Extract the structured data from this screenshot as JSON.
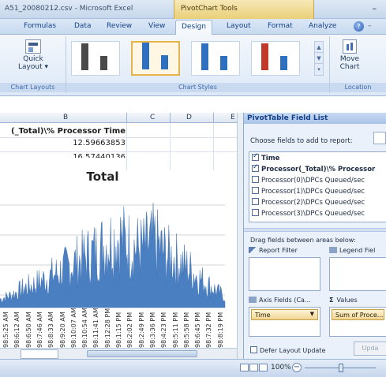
{
  "window": {
    "title": "A51_20080212.csv - Microsoft Excel",
    "context_tools": "PivotChart Tools"
  },
  "ribbon": {
    "tabs": [
      {
        "label": "Formulas"
      },
      {
        "label": "Data"
      },
      {
        "label": "Review"
      },
      {
        "label": "View"
      },
      {
        "label": "Design"
      },
      {
        "label": "Layout"
      },
      {
        "label": "Format"
      },
      {
        "label": "Analyze"
      }
    ],
    "active_tab": "Design",
    "quick_layout_label": "Quick Layout",
    "chart_layouts_group": "Chart Layouts",
    "chart_styles_group": "Chart Styles",
    "move_chart_label": "Move Chart",
    "location_group": "Location",
    "style_swatch_colors": [
      "#4a4a4a",
      "#2f6fbf",
      "#2f6fbf",
      "#c0392b"
    ],
    "selected_style_index": 1
  },
  "sheet": {
    "column_headers": [
      "B",
      "C",
      "D",
      "E"
    ],
    "header_cell": "(_Total)\\% Processor Time",
    "values": [
      "12.59663853",
      "16.57440136"
    ]
  },
  "chart": {
    "title": "Total",
    "series_color": "#4a7fc1",
    "x_labels": [
      "98:5:25 AM",
      "98:6:12 AM",
      "98:6:50 AM",
      "98:7:46 AM",
      "98:8:33 AM",
      "98:9:20 AM",
      "98:10:07 AM",
      "98:10:54 AM",
      "98:11:41 AM",
      "98:12:28 PM",
      "98:1:15 PM",
      "98:2:02 PM",
      "98:2:49 PM",
      "98:3:36 PM",
      "98:4:23 PM",
      "98:5:11 PM",
      "98:5:58 PM",
      "98:6:45 PM",
      "98:7:32 PM",
      "98:8:19 PM"
    ]
  },
  "chart_data": {
    "type": "area",
    "title": "Total",
    "x": [
      "98:5:25 AM",
      "98:6:12 AM",
      "98:6:50 AM",
      "98:7:46 AM",
      "98:8:33 AM",
      "98:9:20 AM",
      "98:10:07 AM",
      "98:10:54 AM",
      "98:11:41 AM",
      "98:12:28 PM",
      "98:1:15 PM",
      "98:2:02 PM",
      "98:2:49 PM",
      "98:3:36 PM",
      "98:4:23 PM",
      "98:5:11 PM",
      "98:5:58 PM",
      "98:6:45 PM",
      "98:7:32 PM",
      "98:8:19 PM"
    ],
    "series": [
      {
        "values": [
          8,
          12,
          18,
          22,
          28,
          33,
          40,
          46,
          52,
          60,
          66,
          58,
          55,
          62,
          50,
          44,
          36,
          26,
          18,
          10
        ]
      }
    ],
    "xlabel": "",
    "ylabel": "",
    "grid": true
  },
  "pivot": {
    "title": "PivotTable Field List",
    "choose_label": "Choose fields to add to report:",
    "fields": [
      {
        "label": "Time",
        "checked": true,
        "bold": true
      },
      {
        "label": "Processor(_Total)\\% Processor",
        "checked": true,
        "bold": true
      },
      {
        "label": "Processor(0)\\DPCs Queued/sec",
        "checked": false,
        "bold": false
      },
      {
        "label": "Processor(1)\\DPCs Queued/sec",
        "checked": false,
        "bold": false
      },
      {
        "label": "Processor(2)\\DPCs Queued/sec",
        "checked": false,
        "bold": false
      },
      {
        "label": "Processor(3)\\DPCs Queued/sec",
        "checked": false,
        "bold": false
      }
    ],
    "drag_label": "Drag fields between areas below:",
    "report_filter": "Report Filter",
    "legend_fields": "Legend Fiel",
    "axis_fields": "Axis Fields (Ca...",
    "values_label": "Values",
    "axis_pill": "Time",
    "values_pill": "Sum of Proce...",
    "defer_label": "Defer Layout Update",
    "update_button": "Upda"
  },
  "statusbar": {
    "zoom": "100%"
  }
}
